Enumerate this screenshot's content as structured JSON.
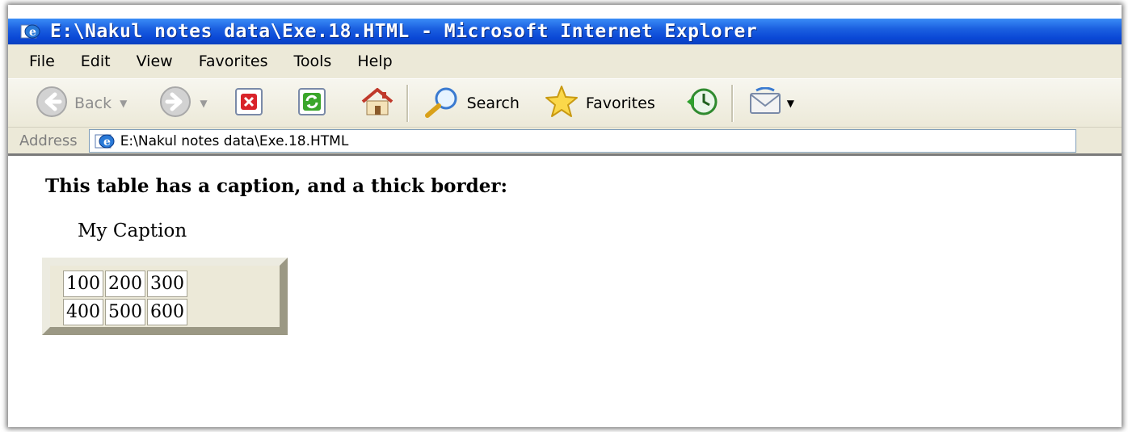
{
  "window": {
    "title": "E:\\Nakul notes data\\Exe.18.HTML - Microsoft Internet Explorer",
    "title_icon": "ie-page-icon"
  },
  "menu": [
    "File",
    "Edit",
    "View",
    "Favorites",
    "Tools",
    "Help"
  ],
  "toolbar": {
    "back_label": "Back",
    "search_label": "Search",
    "favorites_label": "Favorites"
  },
  "address": {
    "label": "Address",
    "value": "E:\\Nakul notes data\\Exe.18.HTML"
  },
  "page": {
    "heading": "This table has a caption, and a thick border:",
    "caption": "My Caption",
    "table": [
      [
        "100",
        "200",
        "300"
      ],
      [
        "400",
        "500",
        "600"
      ]
    ]
  },
  "colors": {
    "titlebar": "#0a48d6",
    "chrome": "#ece9d8"
  }
}
